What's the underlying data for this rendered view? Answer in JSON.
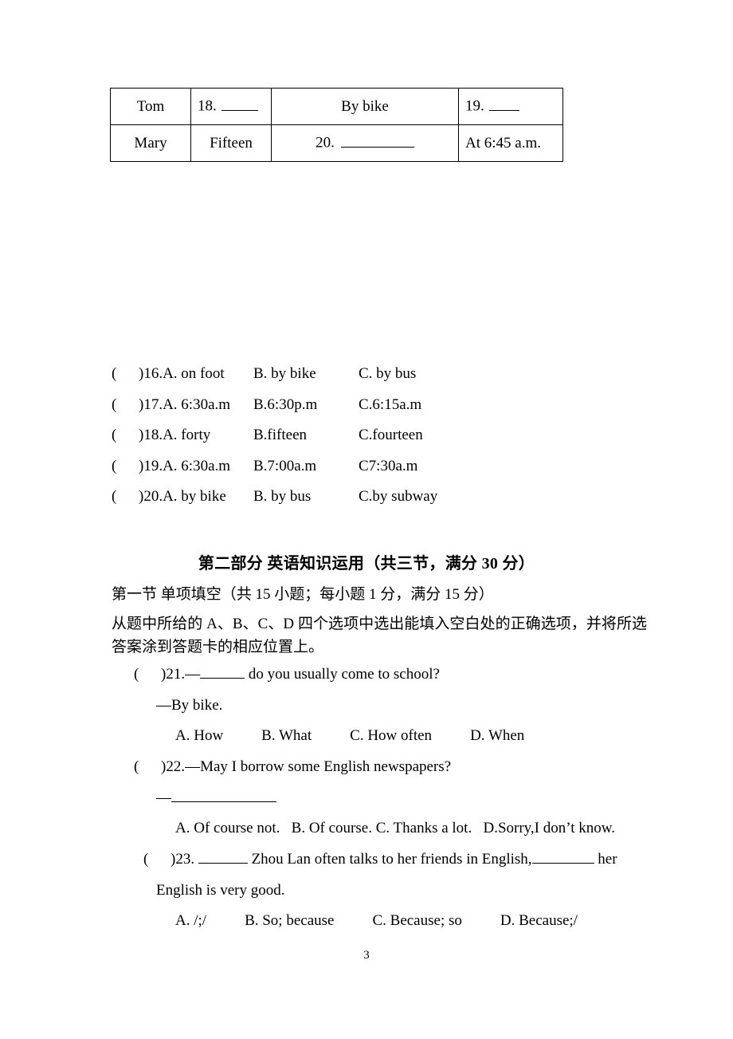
{
  "document": {
    "page_number": "3"
  },
  "info_table": {
    "rows": [
      {
        "name": "Tom",
        "age_cell": "18.",
        "transport_cell": "By bike",
        "time_cell": "19."
      },
      {
        "name": "Mary",
        "age_cell": "Fifteen",
        "transport_cell": "20.",
        "time_cell": "At 6:45 a.m."
      }
    ]
  },
  "listening_choices": [
    {
      "paren": "(",
      "stem": ")16.A. on foot",
      "option_b": "B. by bike",
      "option_c": "C. by bus"
    },
    {
      "paren": "(",
      "stem": ")17.A. 6:30a.m",
      "option_b": "B.6:30p.m",
      "option_c": "C.6:15a.m"
    },
    {
      "paren": "(",
      "stem": ")18.A. forty",
      "option_b": "B.fifteen",
      "option_c": "C.fourteen"
    },
    {
      "paren": "(",
      "stem": ")19.A. 6:30a.m",
      "option_b": "B.7:00a.m",
      "option_c": "C7:30a.m"
    },
    {
      "paren": "(",
      "stem": ")20.A. by bike",
      "option_b": "B. by bus",
      "option_c": "C.by subway"
    }
  ],
  "part_two": {
    "heading": "第二部分  英语知识运用（共三节，满分 30 分）",
    "section_one": "第一节  单项填空（共 15 小题；每小题 1 分，满分 15 分）",
    "directions": "从题中所给的 A、B、C、D 四个选项中选出能填入空白处的正确选项，并将所选答案涂到答题卡的相应位置上。"
  },
  "questions": [
    {
      "paren": "(",
      "number": ")21.—",
      "stem_after_blank": " do you usually come to school?",
      "answer_line": "—By bike.",
      "options": [
        "A. How",
        "B. What",
        "C. How often",
        "D. When"
      ]
    },
    {
      "paren": "(",
      "number": ")22.—May I borrow some English newspapers?",
      "answer_dash": "—",
      "options": [
        "A. Of course not.",
        "B. Of course.",
        "C. Thanks a lot.",
        "D.Sorry,I don’t know."
      ]
    },
    {
      "paren": "(",
      "number": ")23.",
      "stem_mid": " Zhou Lan often talks to her friends in English,",
      "stem_tail": " her",
      "stem_second_line": "English is very good.",
      "options": [
        "A. /;/",
        "B. So; because",
        "C. Because; so",
        "D. Because;/"
      ]
    }
  ]
}
